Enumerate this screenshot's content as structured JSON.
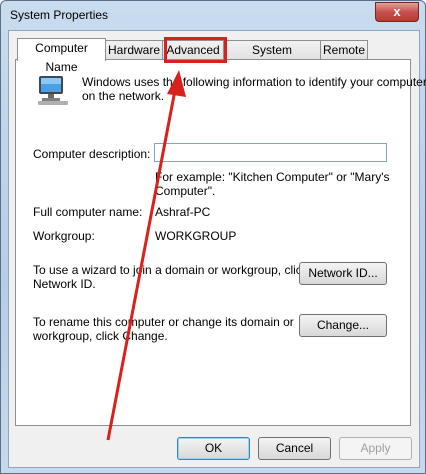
{
  "window": {
    "title": "System Properties",
    "close_glyph": "x"
  },
  "tabs": [
    "Computer Name",
    "Hardware",
    "Advanced",
    "System Protection",
    "Remote"
  ],
  "intro": {
    "line1": "Windows uses the following information to identify your computer",
    "line2": "on the network."
  },
  "description": {
    "label": "Computer description:",
    "value": "",
    "example_line1": "For example: \"Kitchen Computer\" or \"Mary's",
    "example_line2": "Computer\"."
  },
  "full_name": {
    "label": "Full computer name:",
    "value": "Ashraf-PC"
  },
  "workgroup": {
    "label": "Workgroup:",
    "value": "WORKGROUP"
  },
  "network": {
    "line1": "To use a wizard to join a domain or workgroup, click",
    "line2": "Network ID.",
    "button": "Network ID..."
  },
  "rename": {
    "line1": "To rename this computer or change its domain or",
    "line2": "workgroup, click Change.",
    "button": "Change..."
  },
  "footer": {
    "ok": "OK",
    "cancel": "Cancel",
    "apply": "Apply"
  },
  "annotation_color": "#d8201c"
}
